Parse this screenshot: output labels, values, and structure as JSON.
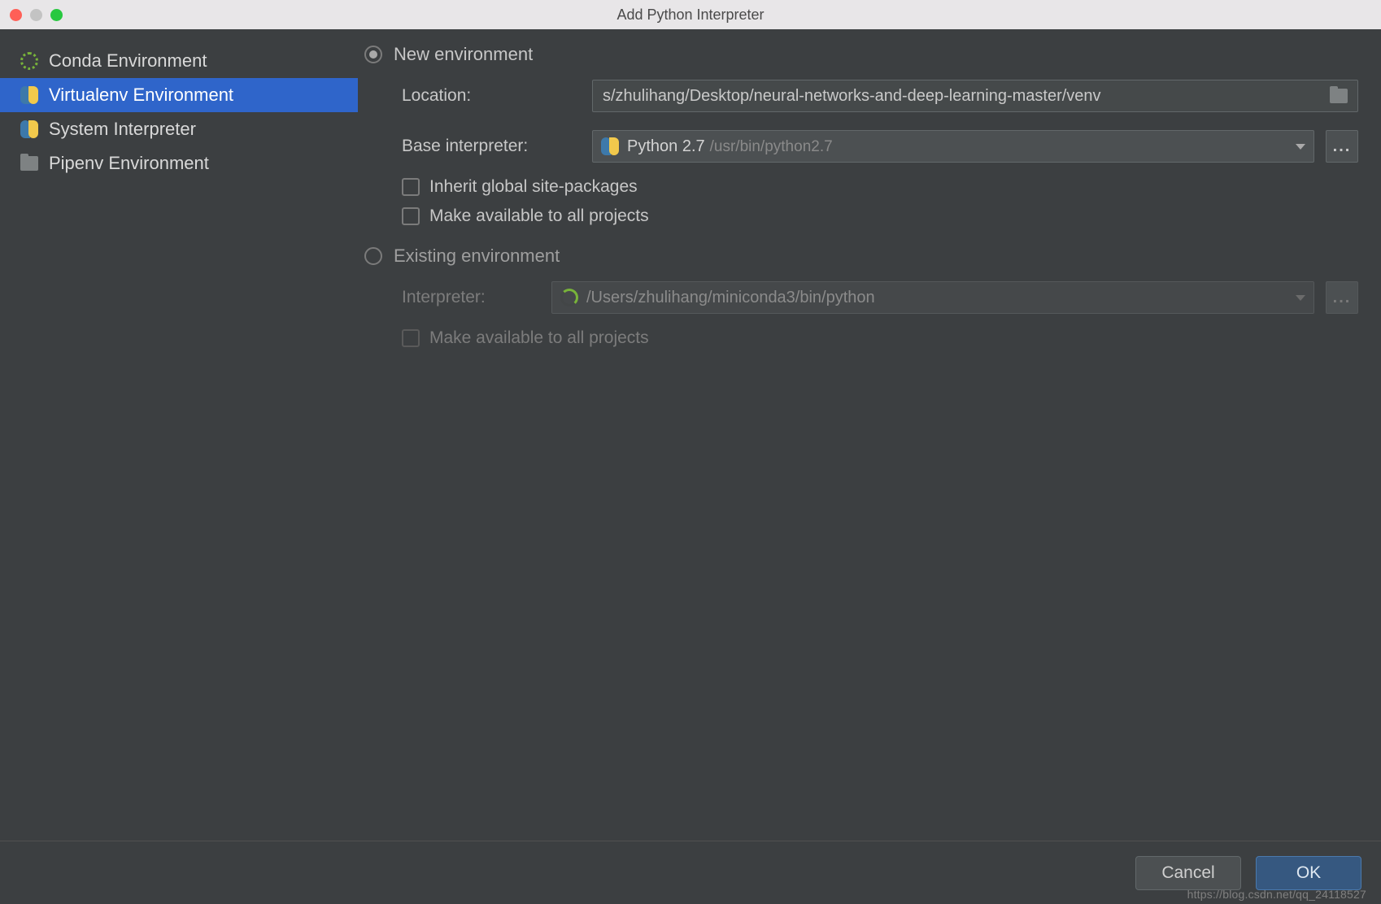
{
  "window": {
    "title": "Add Python Interpreter"
  },
  "sidebar": {
    "items": [
      {
        "label": "Conda Environment"
      },
      {
        "label": "Virtualenv Environment"
      },
      {
        "label": "System Interpreter"
      },
      {
        "label": "Pipenv Environment"
      }
    ],
    "selected_index": 1
  },
  "content": {
    "new_env_label": "New environment",
    "existing_env_label": "Existing environment",
    "selected_mode": "new",
    "location": {
      "label": "Location:",
      "value": "s/zhulihang/Desktop/neural-networks-and-deep-learning-master/venv"
    },
    "base_interpreter": {
      "label": "Base interpreter:",
      "display": "Python 2.7",
      "path": "/usr/bin/python2.7"
    },
    "inherit_global": {
      "label": "Inherit global site-packages",
      "checked": false
    },
    "make_available_new": {
      "label": "Make available to all projects",
      "checked": false
    },
    "existing_interpreter": {
      "label": "Interpreter:",
      "value": "/Users/zhulihang/miniconda3/bin/python"
    },
    "make_available_existing": {
      "label": "Make available to all projects",
      "checked": false
    }
  },
  "footer": {
    "cancel": "Cancel",
    "ok": "OK",
    "watermark": "https://blog.csdn.net/qq_24118527"
  }
}
